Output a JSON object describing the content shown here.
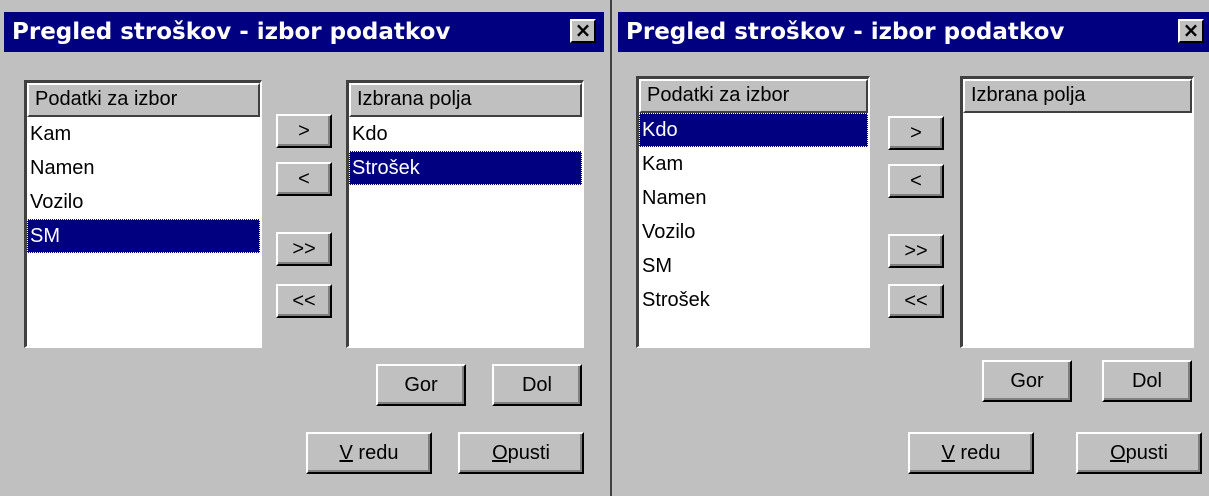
{
  "dialogs": [
    {
      "title": "Pregled stroškov - izbor podatkov",
      "close_glyph": "×",
      "available_header": "Podatki za izbor",
      "available_items": [
        "Kam",
        "Namen",
        "Vozilo",
        "SM"
      ],
      "available_selected": "SM",
      "selected_header": "Izbrana polja",
      "selected_items": [
        "Kdo",
        "Strošek"
      ],
      "selected_selected": "Strošek"
    },
    {
      "title": "Pregled stroškov - izbor podatkov",
      "close_glyph": "×",
      "available_header": "Podatki za izbor",
      "available_items": [
        "Kdo",
        "Kam",
        "Namen",
        "Vozilo",
        "SM",
        "Strošek"
      ],
      "available_selected": "Kdo",
      "selected_header": "Izbrana polja",
      "selected_items": [],
      "selected_selected": ""
    }
  ],
  "buttons": {
    "add": ">",
    "remove": "<",
    "add_all": ">>",
    "remove_all": "<<",
    "up": "Gor",
    "down": "Dol",
    "ok_mnemonic": "V",
    "ok_rest": " redu",
    "cancel_mnemonic": "O",
    "cancel_rest": "pusti"
  }
}
